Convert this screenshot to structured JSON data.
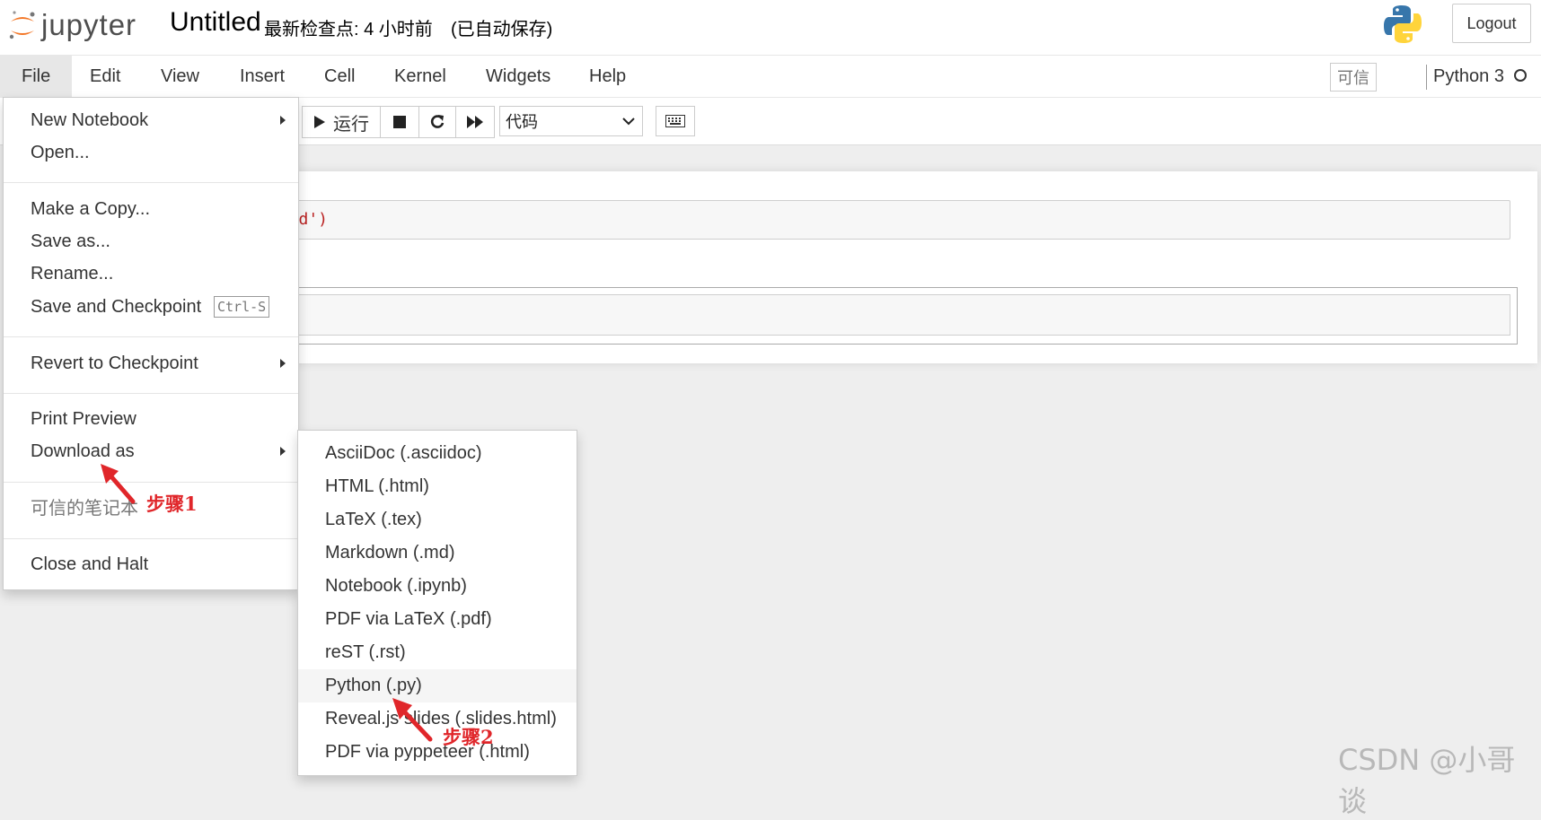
{
  "header": {
    "logo_text": "jupyter",
    "notebook_name": "Untitled",
    "checkpoint": "最新检查点: 4 小时前",
    "autosave": "(已自动保存)",
    "logout_label": "Logout"
  },
  "menubar": {
    "items": [
      "File",
      "Edit",
      "View",
      "Insert",
      "Cell",
      "Kernel",
      "Widgets",
      "Help"
    ],
    "trusted_label": "可信",
    "kernel_name": "Python 3"
  },
  "toolbar": {
    "run_label": "运行",
    "cell_type": "代码"
  },
  "cells": {
    "code_visible": "orld')"
  },
  "file_menu": {
    "new_notebook": "New Notebook",
    "open": "Open...",
    "make_copy": "Make a Copy...",
    "save_as": "Save as...",
    "rename": "Rename...",
    "save_checkpoint": "Save and Checkpoint",
    "save_shortcut": "Ctrl-S",
    "revert": "Revert to Checkpoint",
    "print_preview": "Print Preview",
    "download_as": "Download as",
    "trusted_notebook": "可信的笔记本",
    "close_halt": "Close and Halt"
  },
  "download_submenu": {
    "items": [
      "AsciiDoc (.asciidoc)",
      "HTML (.html)",
      "LaTeX (.tex)",
      "Markdown (.md)",
      "Notebook (.ipynb)",
      "PDF via LaTeX (.pdf)",
      "reST (.rst)",
      "Python (.py)",
      "Reveal.js slides (.slides.html)",
      "PDF via pyppeteer (.html)"
    ]
  },
  "annotations": {
    "step1": "步骤1",
    "step2": "步骤2"
  },
  "watermark": "CSDN @小哥谈",
  "colors": {
    "jupyter_orange": "#f37626",
    "annotation_red": "#e0262a",
    "python_blue": "#3776ab",
    "python_yellow": "#ffd43b"
  }
}
